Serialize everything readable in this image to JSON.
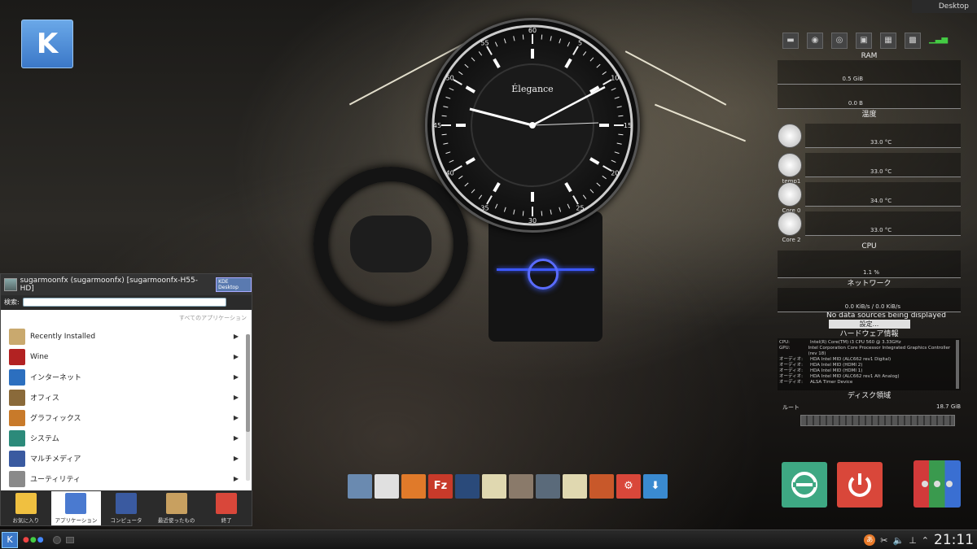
{
  "desktop_label": "Desktop",
  "clock_widget": {
    "brand": "Élegance",
    "hour_labels": [
      "60",
      "5",
      "10",
      "15",
      "20",
      "25",
      "30",
      "35",
      "40",
      "45",
      "50",
      "55"
    ]
  },
  "sysmon": {
    "ram": {
      "title": "RAM",
      "value1": "0.5 GiB",
      "value2": "0.0 B"
    },
    "temp": {
      "title": "温度",
      "sensors": [
        {
          "label": "",
          "value": "33.0 °C"
        },
        {
          "label": "temp1",
          "value": "33.0 °C"
        },
        {
          "label": "Core 0",
          "value": "34.0 °C"
        },
        {
          "label": "Core 2",
          "value": "33.0 °C"
        }
      ]
    },
    "cpu": {
      "title": "CPU",
      "value": "1.1 %"
    },
    "network": {
      "title": "ネットワーク",
      "value": "0.0 KiB/s / 0.0 KiB/s"
    },
    "nodata": "No data sources being displayed",
    "settings": "設定...",
    "hardware": {
      "title": "ハードウェア情報",
      "rows": [
        {
          "k": "CPU:",
          "v": "Intel(R) Core(TM) i3 CPU 560 @ 3.33GHz"
        },
        {
          "k": "GPU:",
          "v": "Intel Corporation Core Processor Integrated Graphics Controller (rev 18)"
        },
        {
          "k": "オーディオ:",
          "v": "HDA Intel MID (ALC662 rev1 Digital)"
        },
        {
          "k": "オーディオ:",
          "v": "HDA Intel MID (HDMI 2)"
        },
        {
          "k": "オーディオ:",
          "v": "HDA Intel MID (HDMI 1)"
        },
        {
          "k": "オーディオ:",
          "v": "HDA Intel MID (ALC662 rev1 Alt Analog)"
        },
        {
          "k": "オーディオ:",
          "v": "ALSA Timer Device"
        }
      ]
    },
    "disk": {
      "title": "ディスク領域",
      "label": "ルート",
      "size": "18.7 GiB"
    }
  },
  "menu": {
    "user": "sugarmoonfx (sugarmoonfx) [sugarmoonfx-H55-HD]",
    "badge": "KDE Desktop",
    "search_label": "検索:",
    "search_value": "",
    "all_apps": "すべてのアプリケーション",
    "items": [
      {
        "label": "Recently Installed",
        "color": "#c9a96e"
      },
      {
        "label": "Wine",
        "color": "#b22222"
      },
      {
        "label": "インターネット",
        "color": "#2c6fbf"
      },
      {
        "label": "オフィス",
        "color": "#8a6a3a"
      },
      {
        "label": "グラフィックス",
        "color": "#c87a2a"
      },
      {
        "label": "システム",
        "color": "#2c8a7a"
      },
      {
        "label": "マルチメディア",
        "color": "#3a5aa0"
      },
      {
        "label": "ユーティリティ",
        "color": "#8a8a8a"
      }
    ],
    "tabs": [
      {
        "label": "お気に入り",
        "color": "#f0c040"
      },
      {
        "label": "アプリケーション",
        "color": "#4a7ad0"
      },
      {
        "label": "コンピュータ",
        "color": "#3a5aa0"
      },
      {
        "label": "最近使ったもの",
        "color": "#c8a060"
      },
      {
        "label": "終了",
        "color": "#d9473a"
      }
    ]
  },
  "dock": [
    {
      "name": "file-manager-icon",
      "color": "#6a8ab0",
      "glyph": ""
    },
    {
      "name": "chrome-icon",
      "color": "#e0e0e0",
      "glyph": ""
    },
    {
      "name": "firefox-icon",
      "color": "#e07a2a",
      "glyph": ""
    },
    {
      "name": "filezilla-icon",
      "color": "#c83a2a",
      "glyph": "Fz"
    },
    {
      "name": "disc-burner-icon",
      "color": "#2a4a7a",
      "glyph": ""
    },
    {
      "name": "notes-icon",
      "color": "#e0d8b0",
      "glyph": ""
    },
    {
      "name": "gimp-icon",
      "color": "#8a7a6a",
      "glyph": ""
    },
    {
      "name": "inkscape-icon",
      "color": "#5a6a7a",
      "glyph": ""
    },
    {
      "name": "text-editor-icon",
      "color": "#e0d8b0",
      "glyph": ""
    },
    {
      "name": "media-player-icon",
      "color": "#c8582a",
      "glyph": ""
    },
    {
      "name": "settings-icon",
      "color": "#d9473a",
      "glyph": "⚙"
    },
    {
      "name": "download-icon",
      "color": "#3a8ad0",
      "glyph": "⬇"
    }
  ],
  "taskbar": {
    "clock": "21:11",
    "ime": "あ"
  }
}
